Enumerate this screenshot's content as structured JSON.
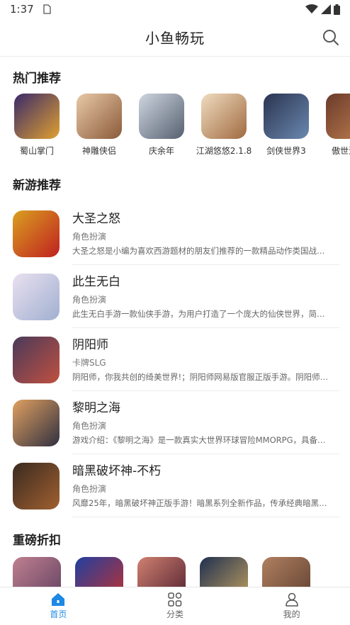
{
  "status_bar": {
    "time": "1:37"
  },
  "header": {
    "title": "小鱼畅玩"
  },
  "sections": {
    "hot": "热门推荐",
    "new": "新游推荐",
    "discount": "重磅折扣"
  },
  "hot_games": [
    {
      "label": "蜀山掌门",
      "c1": "#3a2a6a",
      "c2": "#e0a030"
    },
    {
      "label": "神雕侠侣",
      "c1": "#e9c9a6",
      "c2": "#8a5a3a"
    },
    {
      "label": "庆余年",
      "c1": "#cfd6e0",
      "c2": "#556070"
    },
    {
      "label": "江湖悠悠2.1.8",
      "c1": "#f0dcc0",
      "c2": "#a06a40"
    },
    {
      "label": "剑侠世界3",
      "c1": "#2a3450",
      "c2": "#6a88b0"
    },
    {
      "label": "傲世江山",
      "c1": "#6a3a2a",
      "c2": "#c08050"
    }
  ],
  "new_games": [
    {
      "name": "大圣之怒",
      "category": "角色扮演",
      "desc": "大圣之怒是小编为喜欢西游题材的朋友们推荐的一款精品动作类国战…",
      "c1": "#d9a020",
      "c2": "#c02020"
    },
    {
      "name": "此生无白",
      "category": "角色扮演",
      "desc": "此生无白手游一款仙侠手游，为用户打造了一个庞大的仙侠世界，简…",
      "c1": "#eae0f0",
      "c2": "#a0b0d0"
    },
    {
      "name": "阴阳师",
      "category": "卡牌SLG",
      "desc": "阴阳师，你我共创的绮美世界!；阴阳师网易版官服正版手游。阴阳师…",
      "c1": "#4a3a5a",
      "c2": "#c05040"
    },
    {
      "name": "黎明之海",
      "category": "角色扮演",
      "desc": "游戏介绍：《黎明之海》是一款真实大世界环球冒险MMORPG，具备…",
      "c1": "#e0a060",
      "c2": "#303040"
    },
    {
      "name": "暗黑破坏神-不朽",
      "category": "角色扮演",
      "desc": "风靡25年，暗黑破坏神正版手游！暗黑系列全新作品，传承经典暗黑…",
      "c1": "#3a2a20",
      "c2": "#a06030"
    }
  ],
  "discount_games": [
    {
      "c1": "#c08090",
      "c2": "#604060"
    },
    {
      "c1": "#2040a0",
      "c2": "#c03030"
    },
    {
      "c1": "#d08070",
      "c2": "#502030"
    },
    {
      "c1": "#203050",
      "c2": "#c0a060"
    },
    {
      "c1": "#b08060",
      "c2": "#604030"
    }
  ],
  "tabs": [
    {
      "label": "首页",
      "icon": "home-icon"
    },
    {
      "label": "分类",
      "icon": "category-icon"
    },
    {
      "label": "我的",
      "icon": "profile-icon"
    }
  ],
  "colors": {
    "accent": "#1e88e5"
  }
}
